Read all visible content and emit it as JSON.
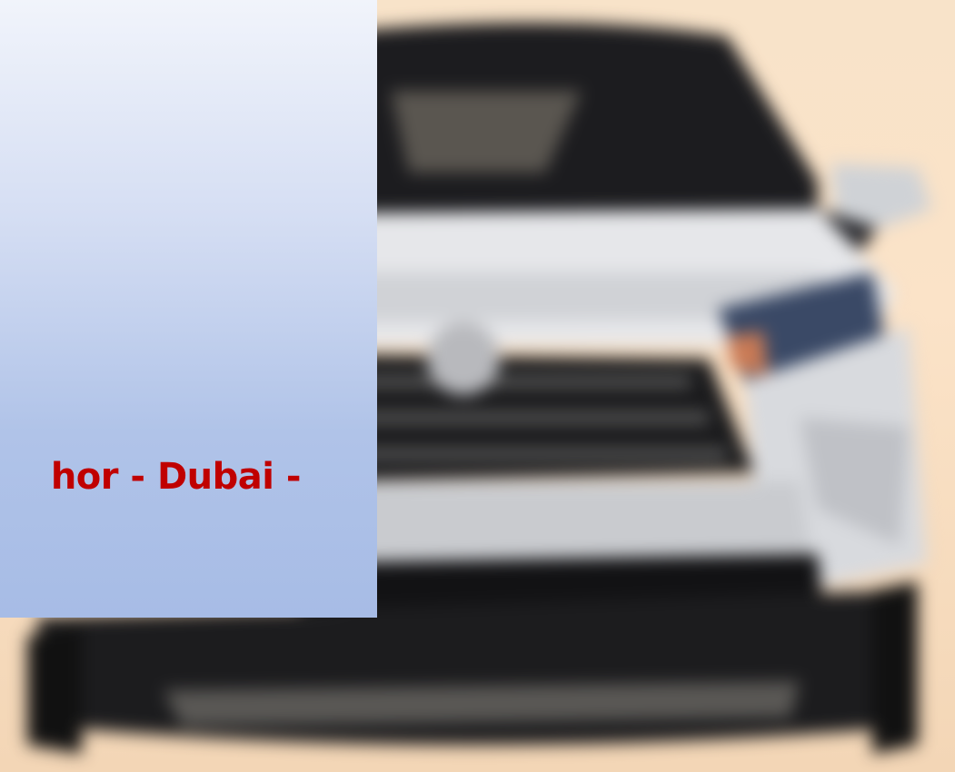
{
  "slide": {
    "caption": "hor - Dubai -"
  },
  "colors": {
    "caption_text": "#c00000",
    "panel_top": "#f1f4fb",
    "panel_bottom": "#a7bce6",
    "backdrop": "#f8e3c9",
    "car_body": "#d7d9de",
    "car_dark": "#1e1e22"
  }
}
